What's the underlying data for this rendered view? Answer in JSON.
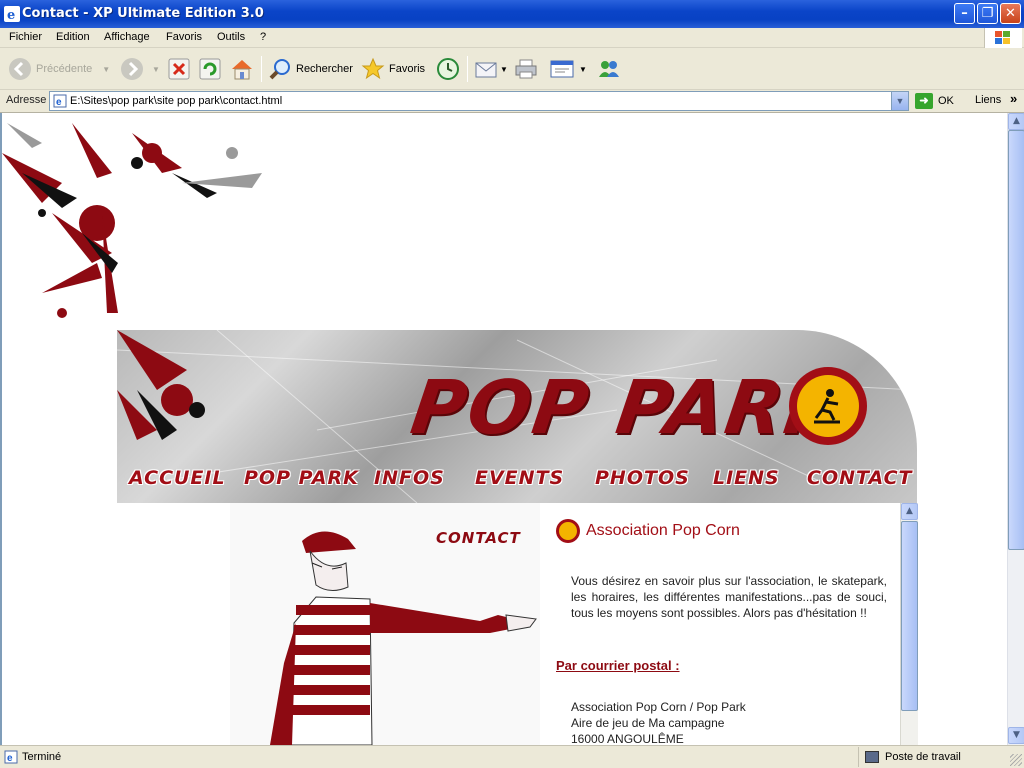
{
  "window": {
    "title": "Contact - XP Ultimate Edition 3.0",
    "buttons": {
      "minimize": "–",
      "restore": "❐",
      "close": "✕"
    }
  },
  "menu": [
    "Fichier",
    "Edition",
    "Affichage",
    "Favoris",
    "Outils",
    "?"
  ],
  "toolbar": {
    "back": "Précédente",
    "search": "Rechercher",
    "favorites": "Favoris"
  },
  "address": {
    "label": "Adresse",
    "value": "E:\\Sites\\pop park\\site pop park\\contact.html",
    "go": "OK",
    "links": "Liens",
    "links_more": "»"
  },
  "site": {
    "logo": "POP PARK",
    "nav": [
      "ACCUEIL",
      "POP PARK",
      "INFOS",
      "EVENTS",
      "PHOTOS",
      "LIENS",
      "CONTACT"
    ],
    "section_tag": "CONTACT",
    "heading": "Association Pop Corn",
    "intro": "Vous désirez en savoir plus sur l'association, le skatepark, les horaires, les différentes manifestations...pas de souci, tous les moyens sont possibles. Alors pas d'hésitation !!",
    "postal_heading": "Par courrier postal :",
    "address_lines": [
      "Association Pop Corn / Pop Park",
      "Aire de jeu de Ma campagne",
      "16000 ANGOULÊME"
    ]
  },
  "colors": {
    "brand_red": "#a20e16",
    "dark_red": "#8d0a12",
    "badge_yellow": "#f4b400"
  },
  "status": {
    "text": "Terminé",
    "zone": "Poste de travail"
  }
}
